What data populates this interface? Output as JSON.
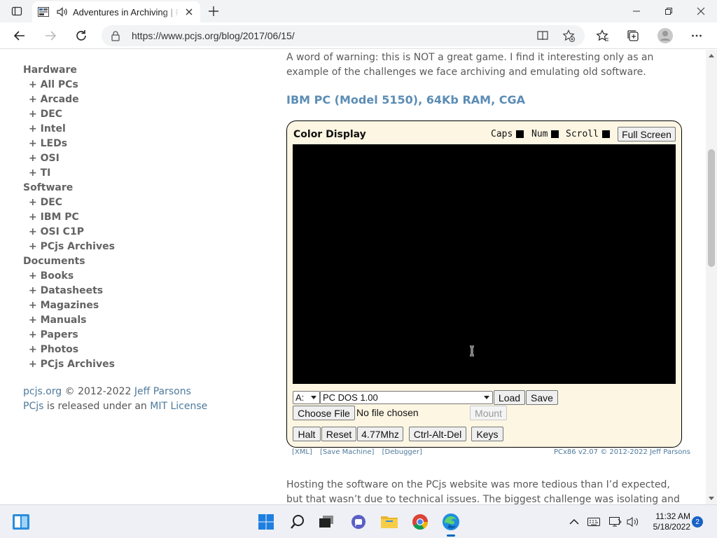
{
  "browser": {
    "tab": {
      "title": "Adventures in Archiving | PCjs"
    },
    "url": "https://www.pcjs.org/blog/2017/06/15/"
  },
  "sidebar": {
    "sections": [
      {
        "title": "Hardware",
        "items": [
          "+ All PCs",
          "+ Arcade",
          "+ DEC",
          "+ Intel",
          "+ LEDs",
          "+ OSI",
          "+ TI"
        ]
      },
      {
        "title": "Software",
        "items": [
          "+ DEC",
          "+ IBM PC",
          "+ OSI C1P",
          "+ PCjs Archives"
        ]
      },
      {
        "title": "Documents",
        "items": [
          "+ Books",
          "+ Datasheets",
          "+ Magazines",
          "+ Manuals",
          "+ Papers",
          "+ Photos",
          "+ PCjs Archives"
        ]
      }
    ],
    "footer": {
      "site": "pcjs.org",
      "copyright": " © 2012-2022 ",
      "author": "Jeff Parsons",
      "pcjs": "PCjs",
      "released": " is released under an ",
      "license": "MIT License"
    }
  },
  "article": {
    "intro": "A word of warning: this is NOT a great game. I find it interesting only as an example of the challenges we face archiving and emulating old software.",
    "heading": "IBM PC (Model 5150), 64Kb RAM, CGA",
    "outro": "Hosting the software on the PCjs website was more tedious than I’d expected, but that wasn’t due to technical issues. The biggest challenge was isolating and"
  },
  "machine": {
    "display_title": "Color Display",
    "leds": {
      "caps": "Caps",
      "num": "Num",
      "scroll": "Scroll"
    },
    "full_screen": "Full Screen",
    "drive": "A:",
    "disk": "PC DOS 1.00",
    "load": "Load",
    "save": "Save",
    "choose_file": "Choose File",
    "no_file": "No file chosen",
    "mount": "Mount",
    "halt": "Halt",
    "reset": "Reset",
    "speed": "4.77Mhz",
    "ctrl_alt_del": "Ctrl-Alt-Del",
    "keys": "Keys",
    "links": {
      "xml": "[XML]",
      "save_machine": "[Save Machine]",
      "debugger": "[Debugger]"
    },
    "version": "PCx86 v2.07 © 2012-2022 ",
    "version_author": "Jeff Parsons"
  },
  "taskbar": {
    "time": "11:32 AM",
    "date": "5/18/2022",
    "notifications": "2"
  },
  "colors": {
    "accent": "#0067c0",
    "link": "#4e7a9c",
    "heading": "#5b8db5",
    "machine_bg": "#fdf6e3"
  }
}
